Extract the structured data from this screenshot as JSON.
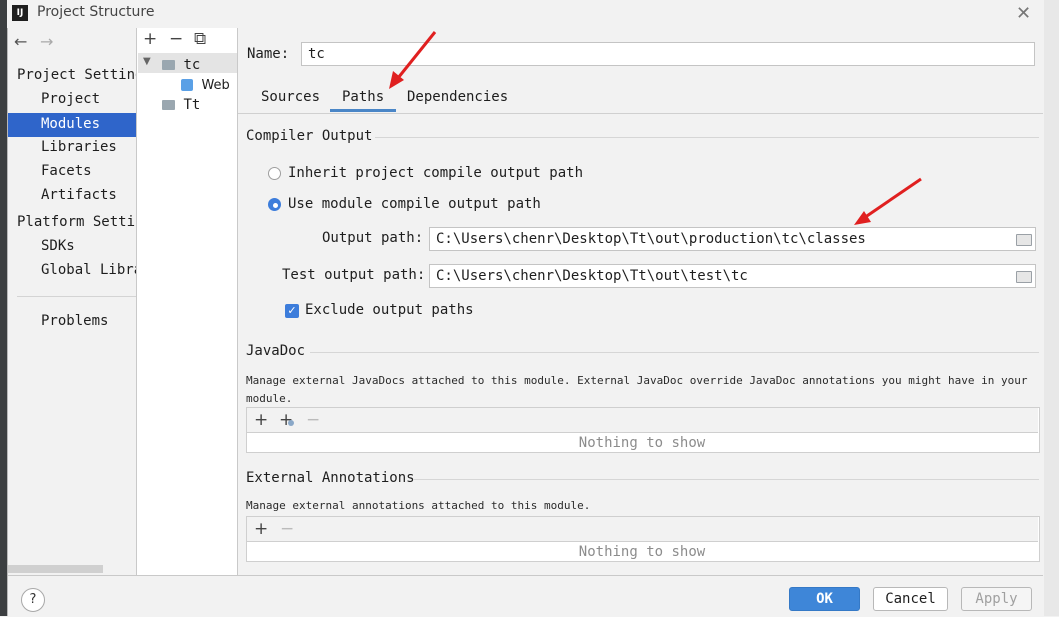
{
  "window": {
    "title": "Project Structure",
    "icon_text": "IJ"
  },
  "sidebar": {
    "sections": [
      {
        "title": "Project Setting",
        "items": [
          "Project",
          "Modules",
          "Libraries",
          "Facets",
          "Artifacts"
        ]
      },
      {
        "title": "Platform Settin",
        "items": [
          "SDKs",
          "Global Libra"
        ]
      }
    ],
    "selected": "Modules",
    "problems": "Problems"
  },
  "tree": {
    "toolbar": {
      "add": "+",
      "remove": "−",
      "copy": "⧉"
    },
    "nodes": [
      {
        "label": "tc",
        "expanded": true,
        "icon": "module-folder-icon"
      },
      {
        "label": "Web",
        "icon": "web-facet-icon"
      },
      {
        "label": "Tt",
        "icon": "module-folder-icon"
      }
    ]
  },
  "main": {
    "name_label": "Name:",
    "name_value": "tc",
    "tabs": [
      "Sources",
      "Paths",
      "Dependencies"
    ],
    "active_tab": "Paths",
    "compiler_output": {
      "title": "Compiler Output",
      "inherit_label": "Inherit project compile output path",
      "use_module_label": "Use module compile output path",
      "output_path_label": "Output path:",
      "output_path_value": "C:\\Users\\chenr\\Desktop\\Tt\\out\\production\\tc\\classes",
      "test_output_path_label": "Test output path:",
      "test_output_path_value": "C:\\Users\\chenr\\Desktop\\Tt\\out\\test\\tc",
      "exclude_label": "Exclude output paths",
      "exclude_checked": true,
      "selected_option": "use_module"
    },
    "javadoc": {
      "title": "JavaDoc",
      "description": "Manage external JavaDocs attached to this module. External JavaDoc override JavaDoc annotations you might have in your module.",
      "empty_text": "Nothing to show"
    },
    "external_annotations": {
      "title": "External Annotations",
      "description": "Manage external annotations attached to this module.",
      "empty_text": "Nothing to show"
    }
  },
  "footer": {
    "help": "?",
    "ok": "OK",
    "cancel": "Cancel",
    "apply": "Apply"
  },
  "colors": {
    "accent": "#3e86d8",
    "selection": "#2f65ca",
    "arrow": "#e02020"
  }
}
